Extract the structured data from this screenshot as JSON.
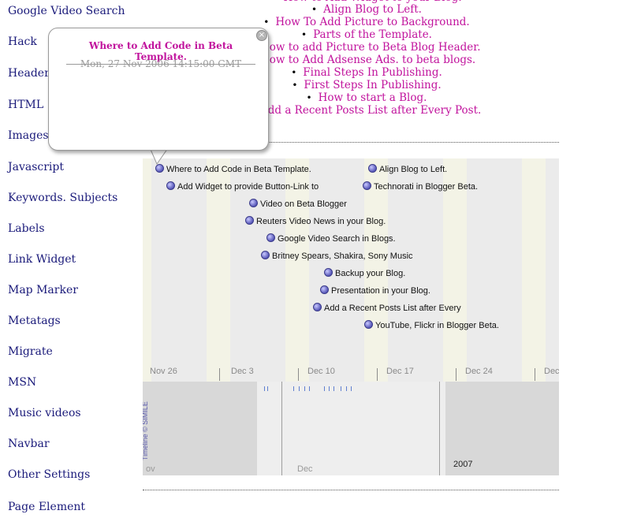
{
  "sidebar": {
    "labels": [
      "Google Video Search",
      "Hack",
      "Header",
      "HTML",
      "Images",
      "Javascript",
      "Keywords. Subjects",
      "Labels",
      "Link Widget",
      "Map Marker",
      "Metatags",
      "Migrate",
      "MSN",
      "Music videos",
      "Navbar",
      "Other Settings",
      "Page Element"
    ]
  },
  "recent_posts": [
    "How to Add Widget to your Blog.",
    "Align Blog to Left.",
    "How To Add Picture to Background.",
    "Parts of the Template.",
    "How to add Picture to Beta Blog Header.",
    "How to Add Adsense Ads. to beta blogs.",
    "Final Steps In Publishing.",
    "First Steps In Publishing.",
    "How to start a Blog.",
    "Add a Recent Posts List after Every Post."
  ],
  "popup": {
    "title": "Where to Add Code in Beta Template.",
    "date": "Mon, 27 Nov 2006 14:15:00 GMT",
    "close_glyph": "×"
  },
  "timeline": {
    "events": [
      "Where to Add Code in Beta Template.",
      "Align Blog to Left.",
      "Add Widget to provide Button-Link to",
      "Technorati in Blogger Beta.",
      "Video on Beta Blogger",
      "Reuters Video News in your Blog.",
      "Google Video Search in Blogs.",
      "Britney Spears, Shakira, Sony Music",
      "Backup your Blog.",
      "Presentation in your Blog.",
      "Add a Recent Posts List after Every",
      "YouTube, Flickr in Blogger Beta."
    ],
    "week_labels": [
      "Nov 26",
      "Dec 3",
      "Dec 10",
      "Dec 17",
      "Dec 24",
      "Dec"
    ],
    "month_labels": [
      "ov",
      "Dec",
      "2007"
    ],
    "credit": "Timeline © SIMILE",
    "colors": {
      "event_dot": "#5656b8",
      "weekend_stripe": "#f3f3e6",
      "post_link": "#c1139d"
    }
  }
}
